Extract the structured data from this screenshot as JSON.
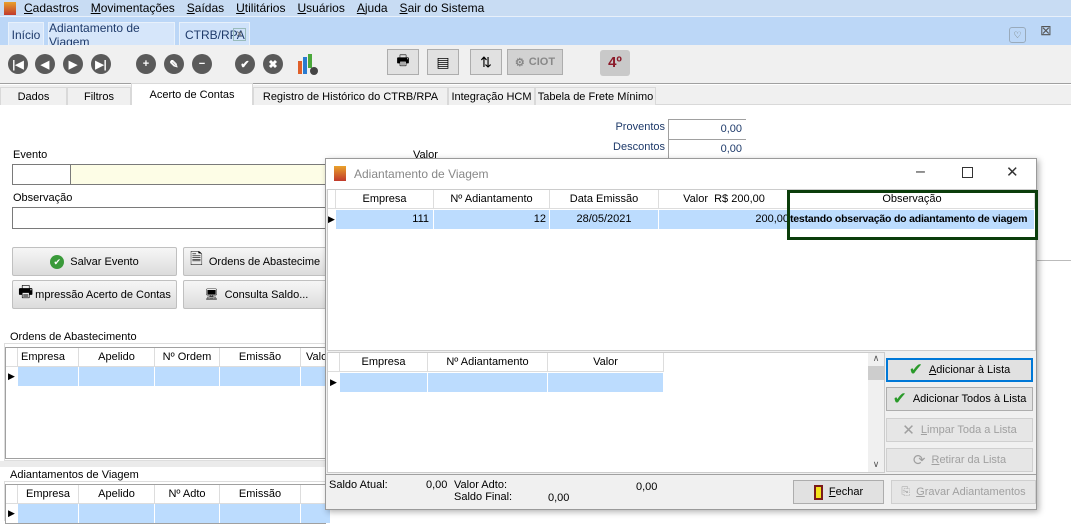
{
  "menu": [
    "Cadastros",
    "Movimentações",
    "Saídas",
    "Utilitários",
    "Usuários",
    "Ajuda",
    "Sair do Sistema"
  ],
  "doc_tabs": [
    "Início",
    "Adiantamento de Viagem",
    "CTRB/RPA"
  ],
  "toolbar": {
    "ciot_label": "CIOT"
  },
  "sub_tabs": [
    "Dados",
    "Filtros",
    "Acerto de Contas",
    "Registro de Histórico do CTRB/RPA",
    "Integração HCM",
    "Tabela de Frete Mínimo"
  ],
  "form": {
    "proventos_label": "Proventos",
    "proventos_value": "0,00",
    "descontos_label": "Descontos",
    "descontos_value": "0,00",
    "evento_label": "Evento",
    "valor_label": "Valor",
    "observacao_label": "Observação",
    "salvar_evento": "Salvar Evento",
    "ordens_abastecimento": "Ordens de Abastecime",
    "impressao": "mpressão Acerto de Contas",
    "consulta_saldo": "Consulta Saldo..."
  },
  "ordens_group": {
    "title": "Ordens de Abastecimento",
    "columns": [
      "Empresa",
      "Apelido",
      "Nº Ordem",
      "Emissão",
      "Valo"
    ]
  },
  "adiant_group": {
    "title": "Adiantamentos de Viagem",
    "columns": [
      "Empresa",
      "Apelido",
      "Nº Adto",
      "Emissão"
    ]
  },
  "dialog": {
    "title": "Adiantamento de Viagem",
    "upper_columns": [
      "Empresa",
      "Nº Adiantamento",
      "Data Emissão",
      "Valor  R$ 200,00",
      "Observação"
    ],
    "upper_rows": [
      [
        "111",
        "12",
        "28/05/2021",
        "200,00",
        "testando observação do adiantamento de viagem"
      ]
    ],
    "lower_columns": [
      "Empresa",
      "Nº Adiantamento",
      "Valor"
    ],
    "buttons": {
      "add": "Adicionar à Lista",
      "add_all": "Adicionar Todos à Lista",
      "clear": "Limpar Toda a Lista",
      "remove": "Retirar da Lista",
      "close": "Fechar",
      "save": "Gravar Adiantamentos"
    },
    "footer": {
      "saldo_atual_label": "Saldo Atual:",
      "saldo_atual": "0,00",
      "valor_adto_label": "Valor Adto:",
      "valor_adto": "0,00",
      "saldo_final_label": "Saldo Final:",
      "saldo_final": "0,00"
    }
  },
  "colors": {
    "highlight_row": "#bcdcfe",
    "obs_border": "#0b3d0b"
  }
}
